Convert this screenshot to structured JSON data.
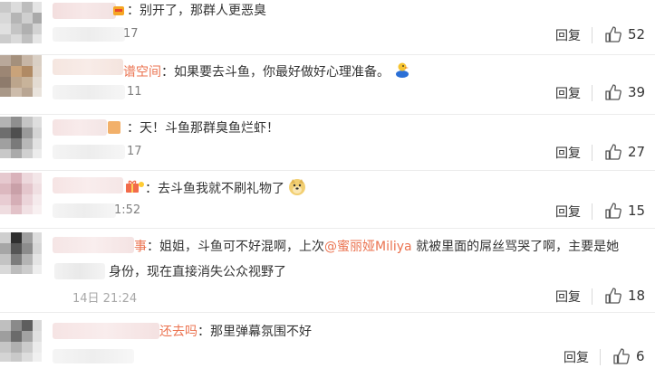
{
  "comments": [
    {
      "nick_tail": "",
      "text_1": "：别开了，那群人更恶臭",
      "text_2": "",
      "mention": "",
      "text_3": "",
      "text_line2": "",
      "time": "17",
      "reply": "回复",
      "likes": "52"
    },
    {
      "nick_tail": "谱空间",
      "text_1": "：如果要去斗鱼，你最好做好心理准备。",
      "text_2": "",
      "mention": "",
      "text_3": "",
      "text_line2": "",
      "time": "11",
      "reply": "回复",
      "likes": "39"
    },
    {
      "nick_tail": "",
      "text_1": "：天！斗鱼那群臭鱼烂虾！",
      "text_2": "",
      "mention": "",
      "text_3": "",
      "text_line2": "",
      "time": "17",
      "reply": "回复",
      "likes": "27"
    },
    {
      "nick_tail": "",
      "text_1": "：去斗鱼我就不刷礼物了",
      "text_2": "",
      "mention": "",
      "text_3": "",
      "text_line2": "",
      "time": "1:52",
      "reply": "回复",
      "likes": "15"
    },
    {
      "nick_tail": "事",
      "text_1": "：姐姐，斗鱼可不好混啊，上次",
      "text_2": "",
      "mention": "@蜜丽娅Miliya",
      "text_3": " 就被里面的屌丝骂哭了啊，主要是她",
      "text_line2": "身份，现在直接消失公众视野了",
      "time": "14日 21:24",
      "reply": "回复",
      "likes": "18"
    },
    {
      "nick_tail": "还去吗",
      "text_1": "：那里弹幕氛围不好",
      "text_2": "",
      "mention": "",
      "text_3": "",
      "text_line2": "",
      "time": "",
      "reply": "回复",
      "likes": "6"
    }
  ],
  "colors": {
    "accent": "#eb7350",
    "text": "#333333",
    "muted": "#808080",
    "divider": "#ececec"
  },
  "icons": {
    "like": "thumbs-up-icon",
    "emoji_row2": "rubber-duck-emoji",
    "emoji_row4": "doge-emoji",
    "badge_row4": "gift-badge-icon",
    "badge_row1": "vip-badge-icon"
  }
}
